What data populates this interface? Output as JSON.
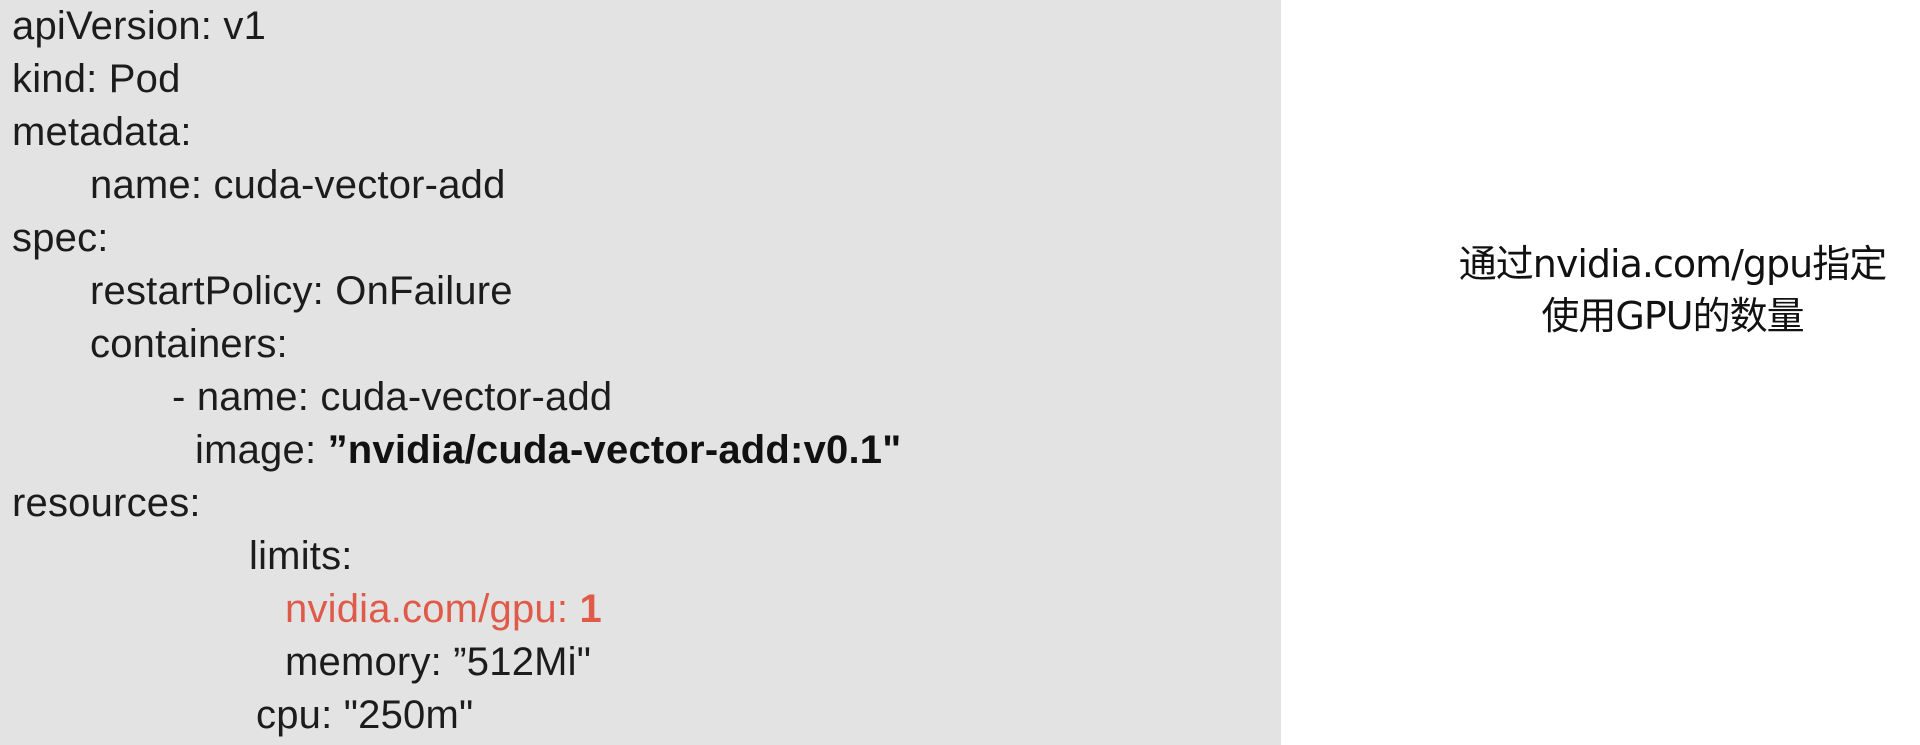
{
  "code": {
    "lines": [
      "apiVersion: v1",
      "kind: Pod",
      "metadata:",
      "name: cuda-vector-add",
      "spec:",
      "restartPolicy: OnFailure",
      "containers:",
      "- name: cuda-vector-add",
      "image: ",
      "”nvidia/cuda-vector-add:v0.1\"",
      "resources:",
      "limits:",
      "nvidia.com/gpu: ",
      "1",
      "memory: ”512Mi\"",
      "cpu: \"250m\""
    ]
  },
  "note": {
    "line1": "通过nvidia.com/gpu指定",
    "line2": "使用GPU的数量"
  },
  "colors": {
    "panel_background": "#e3e3e3",
    "highlight": "#e05a4a",
    "text": "#1c1c1c"
  }
}
